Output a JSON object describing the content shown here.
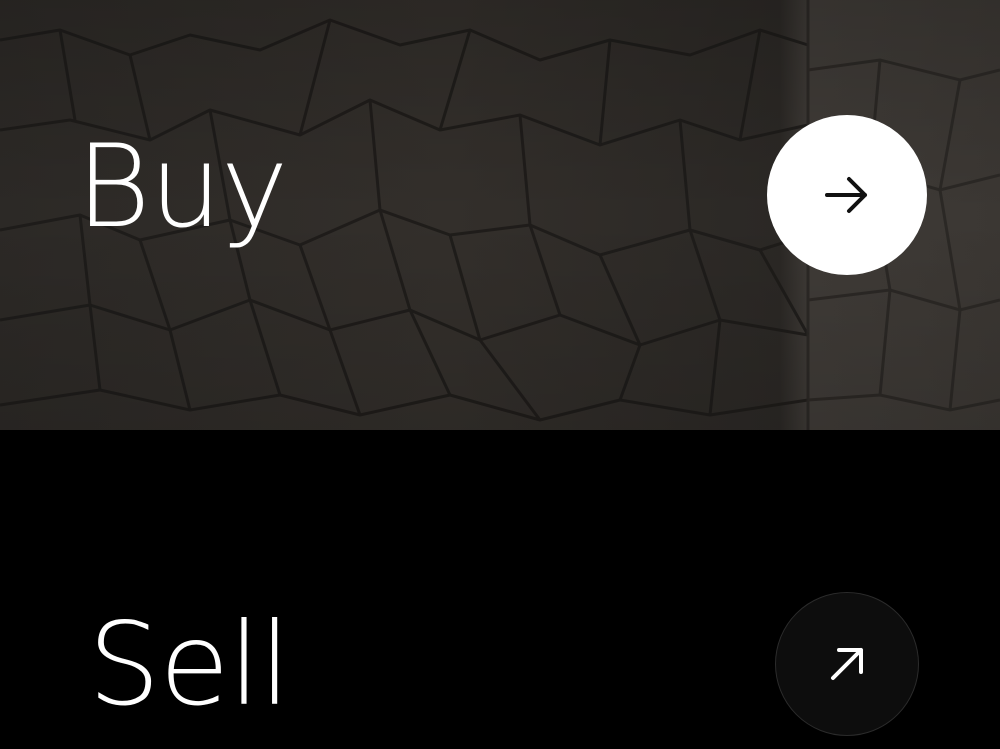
{
  "buy": {
    "label": "Buy",
    "icon": "arrow-right-icon",
    "button_color": "#ffffff",
    "icon_color": "#111111"
  },
  "sell": {
    "label": "Sell",
    "icon": "arrow-up-right-icon",
    "button_color": "#0d0d0d",
    "icon_color": "#ffffff"
  },
  "colors": {
    "background": "#000000",
    "text": "#ffffff",
    "stone": "#3a3632"
  }
}
